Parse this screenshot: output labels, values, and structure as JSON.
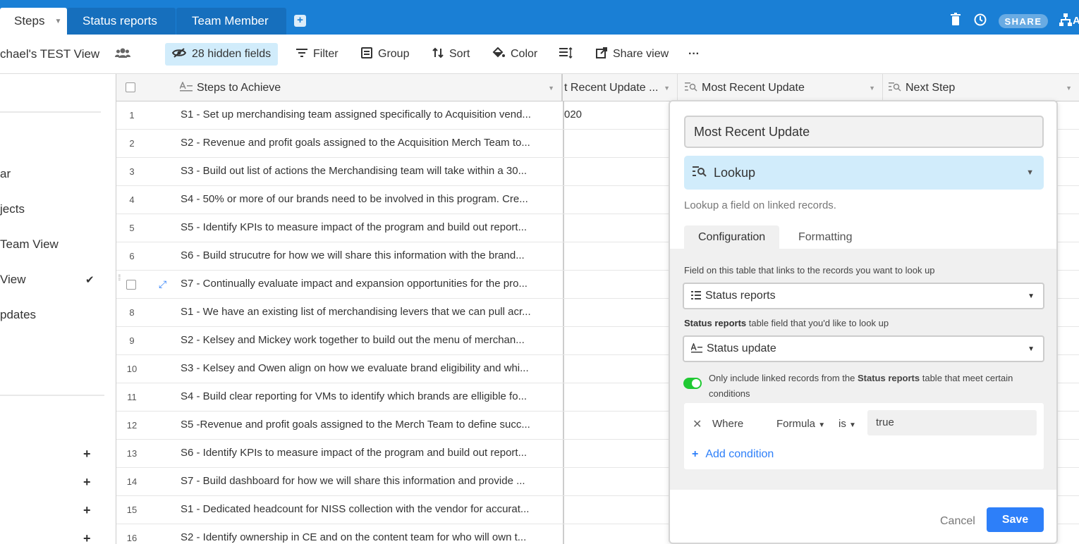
{
  "tabs": [
    {
      "label": "Steps",
      "active": true
    },
    {
      "label": "Status reports",
      "active": false
    },
    {
      "label": "Team Member",
      "active": false
    }
  ],
  "top_actions": {
    "share_label": "SHARE",
    "partial_label": "A"
  },
  "toolbar": {
    "view_name": "chael's TEST View",
    "hidden_fields": "28 hidden fields",
    "filter": "Filter",
    "group": "Group",
    "sort": "Sort",
    "color": "Color",
    "share_view": "Share view",
    "more": "···"
  },
  "sidebar": {
    "items": [
      "ar",
      "jects",
      " Team View",
      " View",
      "pdates"
    ],
    "checkmark": "✔"
  },
  "grid": {
    "columns": {
      "primary": "Steps to Achieve",
      "col2": "t Recent Update ...",
      "col3": "Most Recent Update",
      "col4": "Next Step"
    },
    "first_row_extra": "020",
    "rows": [
      {
        "num": "1",
        "text": "S1 - Set up merchandising team assigned specifically to Acquisition vend..."
      },
      {
        "num": "2",
        "text": "S2 - Revenue and profit goals assigned to the Acquisition Merch Team to..."
      },
      {
        "num": "3",
        "text": "S3 - Build out list of actions the Merchandising team will take within a 30..."
      },
      {
        "num": "4",
        "text": "S4 - 50% or more of our brands need to be involved in this program. Cre..."
      },
      {
        "num": "5",
        "text": "S5 - Identify KPIs to measure impact of the program and build out report..."
      },
      {
        "num": "6",
        "text": "S6 - Build strucutre for how we will share this information with the brand..."
      },
      {
        "num": "",
        "text": "S7 - Continually evaluate impact and expansion opportunities for the pro..."
      },
      {
        "num": "8",
        "text": "S1 - We have an existing list of merchandising levers that we can pull acr..."
      },
      {
        "num": "9",
        "text": "S2 - Kelsey and Mickey work together to build out the menu of merchan..."
      },
      {
        "num": "10",
        "text": "S3 - Kelsey and Owen align on how we evaluate brand eligibility and whi..."
      },
      {
        "num": "11",
        "text": "S4 - Build clear reporting for VMs to identify which brands are elligible fo..."
      },
      {
        "num": "12",
        "text": "S5 -Revenue and profit goals assigned to the Merch Team to define succ..."
      },
      {
        "num": "13",
        "text": "S6 - Identify KPIs to measure impact of the program and build out report..."
      },
      {
        "num": "14",
        "text": "S7 - Build dashboard for how we will share this information and provide ..."
      },
      {
        "num": "15",
        "text": "S1 - Dedicated headcount for NISS collection with the vendor for accurat..."
      },
      {
        "num": "16",
        "text": "S2 - Identify ownership in CE and on the content team for who will own t..."
      }
    ]
  },
  "field_editor": {
    "field_name": "Most Recent Update",
    "field_type": "Lookup",
    "type_description": "Lookup a field on linked records.",
    "tabs": [
      "Configuration",
      "Formatting"
    ],
    "link_label": "Field on this table that links to the records you want to look up",
    "link_value": "Status reports",
    "lookup_label_bold": "Status reports",
    "lookup_label_rest": " table field that you'd like to look up",
    "lookup_value": "Status update",
    "filter_toggle_on": true,
    "filter_text_before": "Only include linked records from the ",
    "filter_text_bold": "Status reports",
    "filter_text_after": " table that meet certain conditions",
    "condition": {
      "where": "Where",
      "field": "Formula",
      "operator": "is",
      "value": "true"
    },
    "add_condition": "Add condition",
    "cancel": "Cancel",
    "save": "Save"
  },
  "colors": {
    "accent": "#1a7fd5",
    "primary_button": "#2d7ff9",
    "toggle_on": "#20c933",
    "highlight": "#d1ecfb"
  }
}
